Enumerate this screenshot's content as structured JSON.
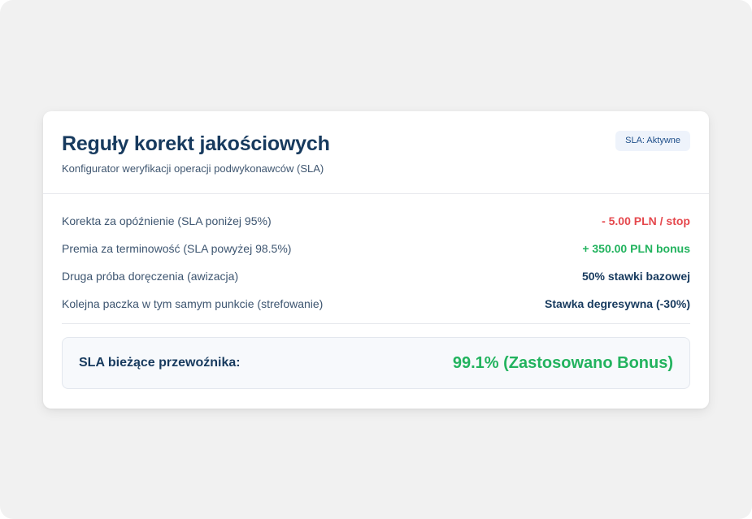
{
  "card": {
    "title": "Reguły korekt jakościowych",
    "subtitle": "Konfigurator weryfikacji operacji podwykonawców (SLA)",
    "status_badge": "SLA: Aktywne"
  },
  "rules": [
    {
      "label": "Korekta za opóźnienie (SLA poniżej 95%)",
      "value": "- 5.00 PLN / stop"
    },
    {
      "label": "Premia za terminowość (SLA powyżej 98.5%)",
      "value": "+ 350.00 PLN bonus"
    },
    {
      "label": "Druga próba doręczenia (awizacja)",
      "value": "50% stawki bazowej"
    },
    {
      "label": "Kolejna paczka w tym samym punkcie (strefowanie)",
      "value": "Stawka degresywna (-30%)"
    }
  ],
  "summary": {
    "label": "SLA bieżące przewoźnika:",
    "value": "99.1% (Zastosowano Bonus)"
  },
  "colors": {
    "title": "#173a5e",
    "negative": "#e5484d",
    "positive": "#22b35e",
    "badge_background": "#eef3fb",
    "badge_text": "#1f4f8a"
  }
}
